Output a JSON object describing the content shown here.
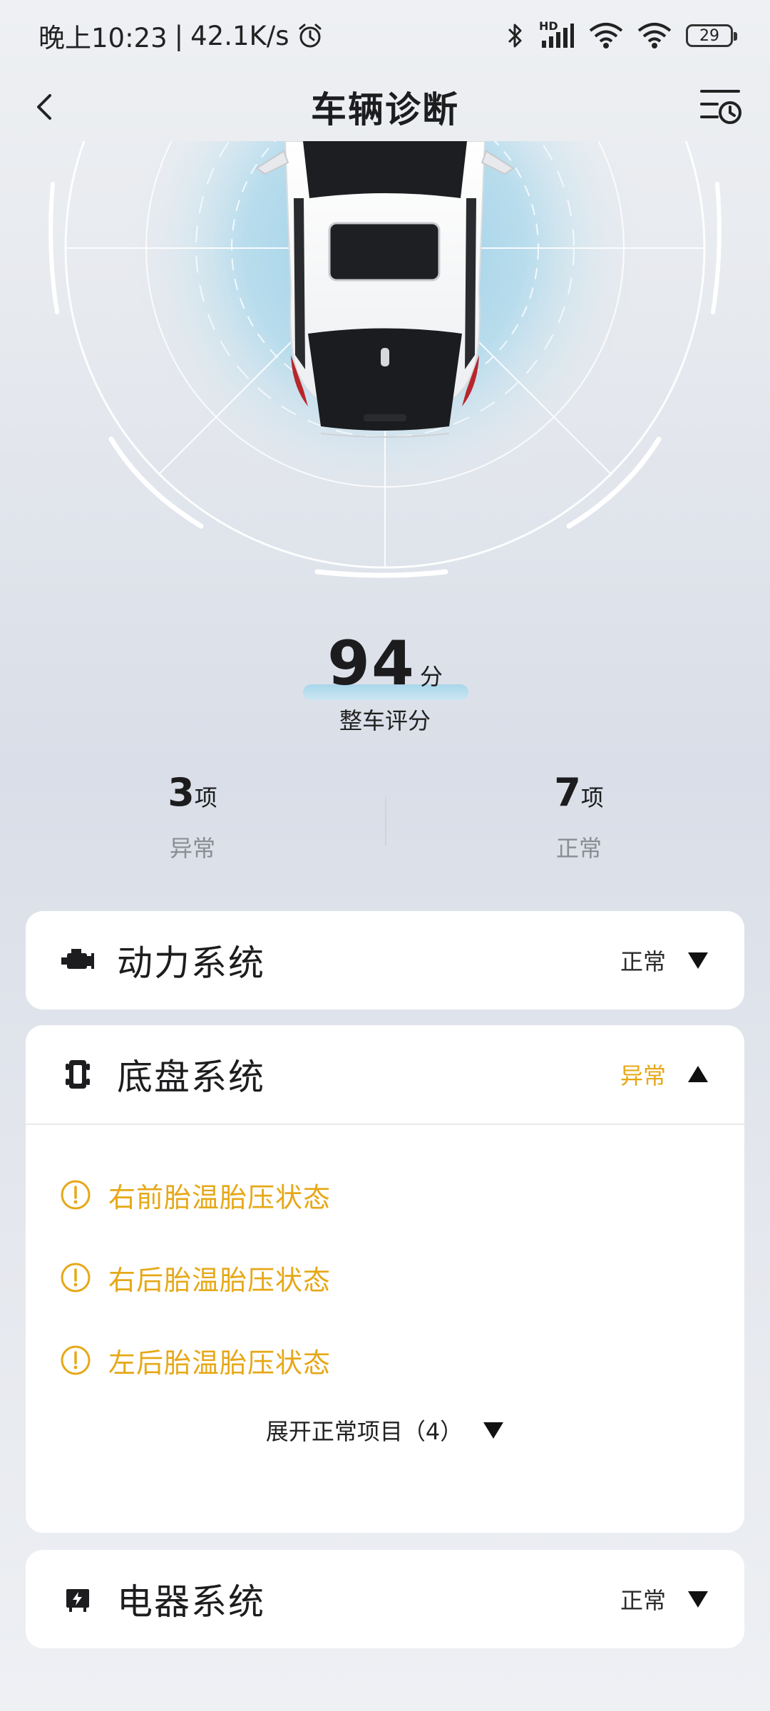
{
  "status_bar": {
    "time": "晚上10:23",
    "speed": "42.1K/s",
    "separator": "|",
    "network": "HD",
    "battery": "29"
  },
  "header": {
    "title": "车辆诊断"
  },
  "score": {
    "value": "94",
    "unit": "分",
    "label": "整车评分"
  },
  "summary": {
    "abnormal_count": "3",
    "abnormal_unit": "项",
    "abnormal_label": "异常",
    "normal_count": "7",
    "normal_unit": "项",
    "normal_label": "正常"
  },
  "systems": [
    {
      "name": "动力系统",
      "status": "正常",
      "icon": "engine-icon",
      "expanded": false
    },
    {
      "name": "底盘系统",
      "status": "异常",
      "icon": "chassis-icon",
      "expanded": true,
      "issues": [
        "右前胎温胎压状态",
        "右后胎温胎压状态",
        "左后胎温胎压状态"
      ],
      "expand_label": "展开正常项目（4）"
    },
    {
      "name": "电器系统",
      "status": "正常",
      "icon": "battery-icon",
      "expanded": false
    }
  ],
  "colors": {
    "warning": "#e6a817",
    "text": "#1d1d1f",
    "muted": "#8a8d93",
    "radar": "#a9d8ec"
  }
}
